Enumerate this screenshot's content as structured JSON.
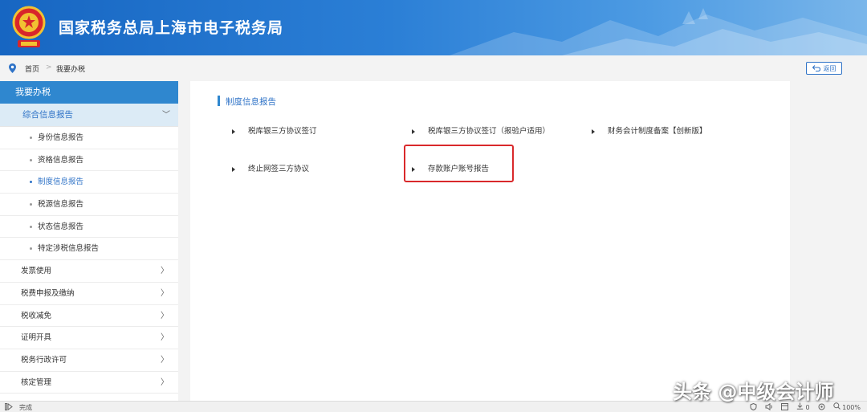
{
  "header": {
    "title": "国家税务总局上海市电子税务局",
    "emblem_icon": "tax-emblem-icon"
  },
  "breadcrumb": {
    "home": "首页",
    "separator": ">",
    "current": "我要办税"
  },
  "back_button": {
    "label": "返回"
  },
  "sidebar": {
    "top": "我要办税",
    "group": "综合信息报告",
    "group_chevron": "﹀",
    "sub_items": [
      {
        "label": "身份信息报告",
        "active": false
      },
      {
        "label": "资格信息报告",
        "active": false
      },
      {
        "label": "制度信息报告",
        "active": true
      },
      {
        "label": "税源信息报告",
        "active": false
      },
      {
        "label": "状态信息报告",
        "active": false
      },
      {
        "label": "特定涉税信息报告",
        "active": false
      }
    ],
    "menus": [
      {
        "label": "发票使用",
        "arrow": "〉"
      },
      {
        "label": "税费申报及缴纳",
        "arrow": "〉"
      },
      {
        "label": "税收减免",
        "arrow": "〉"
      },
      {
        "label": "证明开具",
        "arrow": "〉"
      },
      {
        "label": "税务行政许可",
        "arrow": "〉"
      },
      {
        "label": "核定管理",
        "arrow": "〉"
      }
    ]
  },
  "main": {
    "section_title": "制度信息报告",
    "items": [
      "税库银三方协议签订",
      "税库银三方协议签订（报验户适用）",
      "财务会计制度备案【创新版】",
      "终止网签三方协议",
      "存款账户账号报告"
    ]
  },
  "statusbar": {
    "text": "完成",
    "zoom": "100%",
    "count": "0"
  },
  "watermark": "头条 @中级会计师",
  "colors": {
    "header_blue": "#1766c2",
    "accent_blue": "#2f87cf",
    "link_blue": "#2f73c7",
    "highlight_red": "#d9292b"
  }
}
